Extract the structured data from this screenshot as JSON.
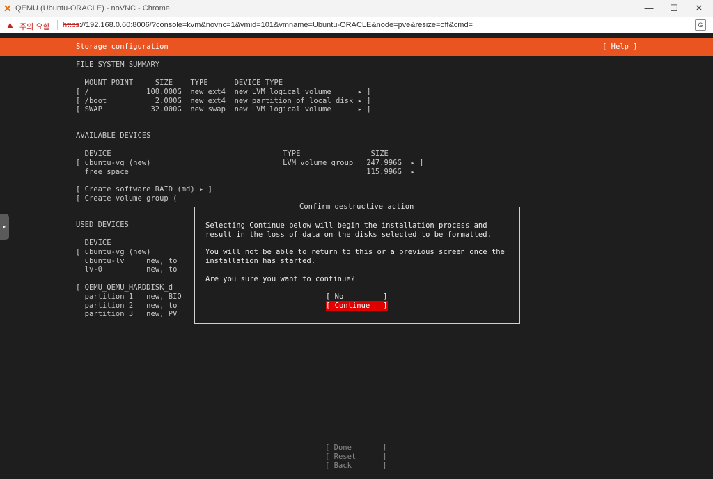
{
  "window": {
    "title": "QEMU (Ubuntu-ORACLE) - noVNC - Chrome",
    "minimize": "—",
    "maximize": "☐",
    "close": "✕"
  },
  "urlbar": {
    "warning": "주의 요함",
    "protocol": "https",
    "url_rest": "://192.168.0.60:8006/?console=kvm&novnc=1&vmid=101&vmname=Ubuntu-ORACLE&node=pve&resize=off&cmd="
  },
  "header": {
    "title": "Storage configuration",
    "help": "[ Help ]"
  },
  "fs_summary": {
    "heading": "FILE SYSTEM SUMMARY",
    "columns": "  MOUNT POINT     SIZE    TYPE      DEVICE TYPE",
    "rows": [
      "[ /             100.000G  new ext4  new LVM logical volume      ▸ ]",
      "[ /boot           2.000G  new ext4  new partition of local disk ▸ ]",
      "[ SWAP           32.000G  new swap  new LVM logical volume      ▸ ]"
    ]
  },
  "available": {
    "heading": "AVAILABLE DEVICES",
    "columns": "  DEVICE                                       TYPE                SIZE",
    "rows": [
      "[ ubuntu-vg (new)                              LVM volume group   247.996G  ▸ ]",
      "  free space                                                      115.996G  ▸"
    ],
    "actions": [
      "[ Create software RAID (md) ▸ ]",
      "[ Create volume group ("
    ]
  },
  "used": {
    "heading": "USED DEVICES",
    "rows": [
      "  DEVICE",
      "[ ubuntu-vg (new)",
      "  ubuntu-lv     new, to",
      "  lv-0          new, to",
      "",
      "[ QEMU_QEMU_HARDDISK_d",
      "  partition 1   new, BIO",
      "  partition 2   new, to",
      "  partition 3   new, PV"
    ]
  },
  "dialog": {
    "title": "Confirm destructive action",
    "para1_l1": "Selecting Continue below will begin the installation process and",
    "para1_l2": "result in the loss of data on the disks selected to be formatted.",
    "para2_l1": "You will not be able to return to this or a previous screen once the",
    "para2_l2": "installation has started.",
    "question": "Are you sure you want to continue?",
    "no": "[ No         ]",
    "continue": "[ Continue   ]"
  },
  "footer": {
    "done": "[ Done       ]",
    "reset": "[ Reset      ]",
    "back": "[ Back       ]"
  }
}
